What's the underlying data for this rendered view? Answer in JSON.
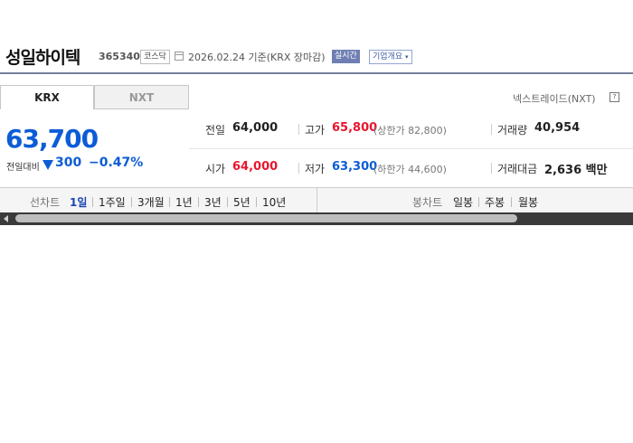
{
  "header": {
    "name": "성일하이텍",
    "code": "365340",
    "market": "코스닥",
    "date": "2026.02.24 기준(KRX 장마감)",
    "realtime": "실시간",
    "company": "기업개요"
  },
  "tabs": {
    "krx": "KRX",
    "nxt": "NXT"
  },
  "nxt_link": "넥스트레이드(NXT)",
  "price": {
    "current": "63,700",
    "change_label": "전일대비",
    "change": "300",
    "rate": "−0.47%"
  },
  "stats": {
    "prev_label": "전일",
    "prev": "64,000",
    "high_label": "고가",
    "high": "65,800",
    "upper_limit": "(상한가 82,800)",
    "volume_label": "거래량",
    "volume": "40,954",
    "open_label": "시가",
    "open": "64,000",
    "low_label": "저가",
    "low": "63,300",
    "lower_limit": "(하한가 44,600)",
    "amount_label": "거래대금",
    "amount": "2,636 백만"
  },
  "chart_bar": {
    "line_label": "선차트",
    "line_items": [
      "1일",
      "1주일",
      "3개월",
      "1년",
      "3년",
      "5년",
      "10년"
    ],
    "candle_label": "봉차트",
    "candle_items": [
      "일봉",
      "주봉",
      "월봉"
    ]
  },
  "colors": {
    "down": "#0c5cd6",
    "up": "#e8162f",
    "active": "#1a45b0"
  }
}
